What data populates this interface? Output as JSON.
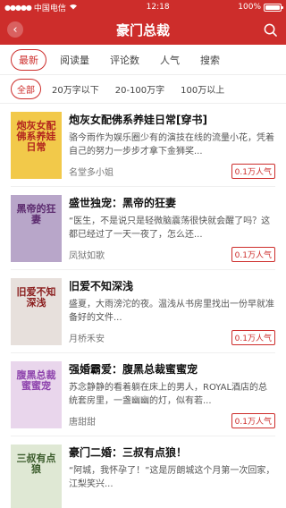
{
  "status": {
    "carrier": "中国电信",
    "time": "12:18",
    "battery_label": "100%",
    "battery_level": 1.0
  },
  "nav": {
    "title": "豪门总裁"
  },
  "sort_tabs": [
    "最新",
    "阅读量",
    "评论数",
    "人气",
    "搜索"
  ],
  "filter_tabs": [
    "全部",
    "20万字以下",
    "20-100万字",
    "100万以上"
  ],
  "books": [
    {
      "title": "炮灰女配佛系养娃日常[穿书]",
      "desc": "骆今雨作为娱乐圈少有的演技在线的流量小花，凭着自己的努力一步步才拿下金狮奖...",
      "author": "名堂多小姐",
      "hot": "0.1万人气",
      "cover_text": "炮灰女配佛系养娃日常",
      "cover_bg": "#f2c94a",
      "cover_fg": "#b3261e"
    },
    {
      "title": "盛世独宠：黑帝的狂妻",
      "desc": "“医生，不是说只是轻微脑震荡很快就会醒了吗？这都已经过了一天一夜了，怎么还...",
      "author": "凤狱如歌",
      "hot": "0.1万人气",
      "cover_text": "黑帝的狂妻",
      "cover_bg": "#b8a6c9",
      "cover_fg": "#5b2a6e"
    },
    {
      "title": "旧爱不知深浅",
      "desc": "盛夏，大雨滂沱的夜。温浅从书房里找出一份早就准备好的文件...",
      "author": "月桥禾安",
      "hot": "0.1万人气",
      "cover_text": "旧爱不知深浅",
      "cover_bg": "#e7e0dc",
      "cover_fg": "#8a1c1c"
    },
    {
      "title": "强婚霸爱：腹黑总裁蜜蜜宠",
      "desc": "苏念静静的看着躺在床上的男人，ROYAL酒店的总统套房里，一盏幽幽的灯，似有若...",
      "author": "唐甜甜",
      "hot": "0.1万人气",
      "cover_text": "腹黑总裁蜜蜜宠",
      "cover_bg": "#e9d6ec",
      "cover_fg": "#8e44ad"
    },
    {
      "title": "豪门二婚：三叔有点狼！",
      "desc": "“阿城，我怀孕了！”这是厉朗城这个月第一次回家，江梨笑兴...",
      "author": "",
      "hot": "",
      "cover_text": "三叔有点狼",
      "cover_bg": "#dfe8d4",
      "cover_fg": "#3a5a2a"
    }
  ]
}
